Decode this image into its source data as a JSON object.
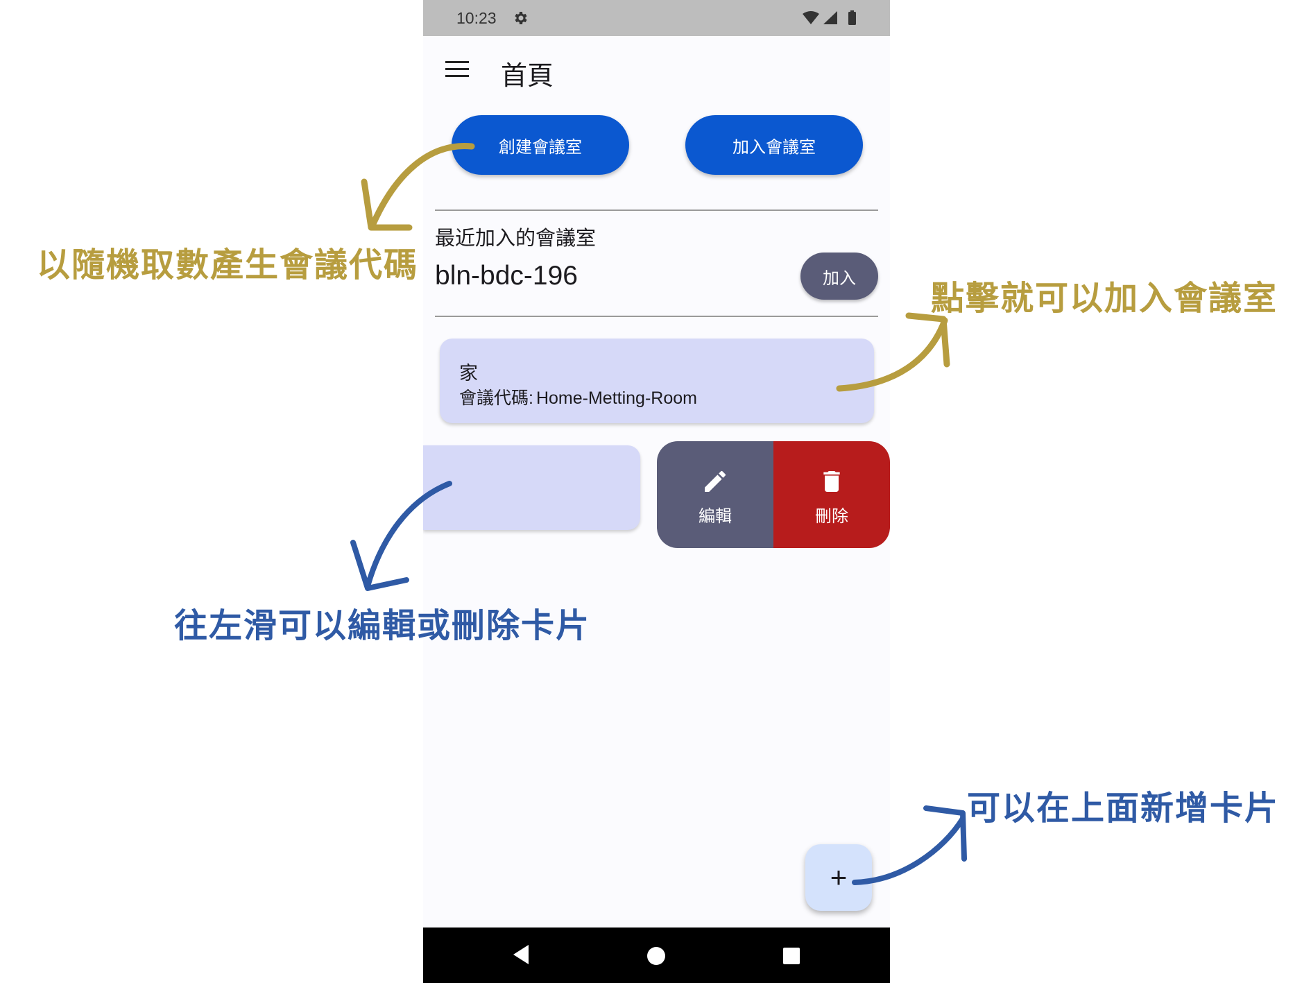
{
  "status_bar": {
    "time": "10:23",
    "icons": [
      "gear-icon",
      "wifi-icon",
      "signal-icon",
      "battery-icon"
    ]
  },
  "app_bar": {
    "menu_icon": "menu-icon",
    "title": "首頁"
  },
  "buttons": {
    "create_room": "創建會議室",
    "join_room": "加入會議室"
  },
  "recent": {
    "label": "最近加入的會議室",
    "code": "bln-bdc-196",
    "join_label": "加入"
  },
  "cards": [
    {
      "title": "家",
      "code_label": "會議代碼:",
      "code_value": "Home-Metting-Room"
    }
  ],
  "swipe_actions": {
    "edit_label": "編輯",
    "delete_label": "刪除",
    "edit_icon": "pencil-icon",
    "delete_icon": "trash-icon"
  },
  "fab": {
    "symbol": "+"
  },
  "nav_bar": {
    "icons": [
      "back-icon",
      "home-icon",
      "recents-icon"
    ]
  },
  "annotations": {
    "random_code": "以隨機取數產生會議代碼",
    "click_join": "點擊就可以加入會議室",
    "swipe_left": "往左滑可以編輯或刪除卡片",
    "add_card": "可以在上面新增卡片"
  },
  "colors": {
    "primary": "#0b58d0",
    "secondary": "#5a5c78",
    "danger": "#b71c1c",
    "card": "#d6d9f8",
    "fab": "#d4e2fc",
    "annotation_gold": "#b79d3f",
    "annotation_blue": "#2f5aa5"
  }
}
